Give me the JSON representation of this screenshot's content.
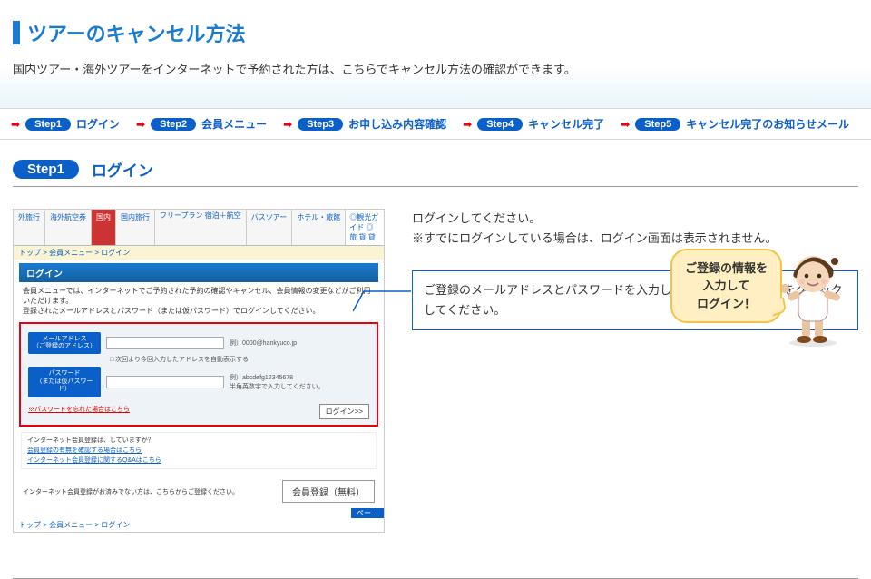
{
  "header": {
    "title": "ツアーのキャンセル方法",
    "subtitle": "国内ツアー・海外ツアーをインターネットで予約された方は、こちらでキャンセル方法の確認ができます。"
  },
  "steps": [
    {
      "pill": "Step1",
      "label": "ログイン"
    },
    {
      "pill": "Step2",
      "label": "会員メニュー"
    },
    {
      "pill": "Step3",
      "label": "お申し込み内容確認"
    },
    {
      "pill": "Step4",
      "label": "キャンセル完了"
    },
    {
      "pill": "Step5",
      "label": "キャンセル完了のお知らせメール"
    }
  ],
  "section": {
    "pill": "Step1",
    "title": "ログイン"
  },
  "right": {
    "line1": "ログインしてください。",
    "line2": "※すでにログインしている場合は、ログイン画面は表示されません。",
    "callout": "ご登録のメールアドレスとパスワードを入力し、「ログイン」ボタンをクリックしてください。",
    "bubble_l1": "ご登録の情報を",
    "bubble_l2": "入力して",
    "bubble_l3": "ログイン！"
  },
  "mock": {
    "tabs": {
      "t1": "外旅行",
      "t2": "海外航空券",
      "t3": "国内",
      "t4": "国内旅行",
      "t5": "フリープラン\n宿泊＋航空",
      "t6": "バスツアー",
      "t7": "ホテル・旅館",
      "right": "◎観光ガイド  ◎旅 貨 貸"
    },
    "crumbs": "トップ > 会員メニュー > ログイン",
    "login_h": "ログイン",
    "intro": "会員メニューでは、インターネットでご予約された予約の確認やキャンセル、会員情報の変更などがご利用いただけます。\n登録されたメールアドレスとパスワード（または仮パスワード）でログインしてください。",
    "email_label": "メールアドレス\n（ご登録のアドレス）",
    "email_hint": "例）0000@hankyuco.jp",
    "chk": "□ 次回より今回入力したアドレスを自動表示する",
    "pass_label": "パスワード\n（または仮パスワード）",
    "pass_hint1": "例）abcdefg12345678",
    "pass_hint2": "半角英数字で入力してください。",
    "forgot": "※パスワードを忘れた場合はこちら",
    "login_btn": "ログイン>>",
    "help_q": "インターネット会員登録は、していますか？",
    "help_a1": "会員登録の有無を確認する場合はこちら",
    "help_a2": "インターネット会員登録に関するQ&Aはこちら",
    "reg_msg": "インターネット会員登録がお済みでない方は、こちらからご登録ください。",
    "reg_btn": "会員登録（無料）",
    "pager": "ペー…",
    "crumbs2": "トップ > 会員メニュー > ログイン"
  }
}
